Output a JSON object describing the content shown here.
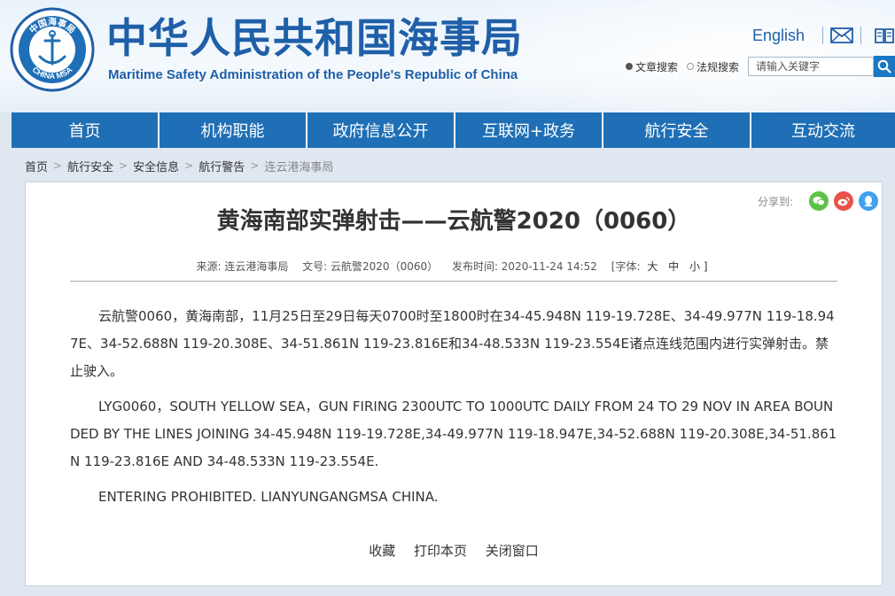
{
  "header": {
    "logo_text_top": "中国海事局",
    "logo_text_bottom": "CHINA MSA",
    "title_cn": "中华人民共和国海事局",
    "title_en": "Maritime Safety Administration of the People's Republic of China",
    "lang_link": "English",
    "search_options": [
      "文章搜索",
      "法规搜索"
    ],
    "search_placeholder": "请输入关键字",
    "accent": "#1f5fa8"
  },
  "nav": {
    "items": [
      "首页",
      "机构职能",
      "政府信息公开",
      "互联网+政务",
      "航行安全",
      "互动交流"
    ],
    "background": "#1f6fb6"
  },
  "breadcrumb": [
    "首页",
    "航行安全",
    "安全信息",
    "航行警告",
    "连云港海事局"
  ],
  "article": {
    "share_label": "分享到:",
    "title": "黄海南部实弹射击——云航警2020（0060）",
    "meta": {
      "source": "来源: 连云港海事局",
      "doc_no": "文号: 云航警2020（0060）",
      "published": "发布时间: 2020-11-24 14:52",
      "font_label": "[字体:",
      "font_large": "大",
      "font_medium": "中",
      "font_small": "小 ]"
    },
    "paragraphs": [
      "云航警0060，黄海南部，11月25日至29日每天0700时至1800时在34-45.948N 119-19.728E、34-49.977N 119-18.947E、34-52.688N 119-20.308E、34-51.861N 119-23.816E和34-48.533N 119-23.554E诸点连线范围内进行实弹射击。禁止驶入。",
      "LYG0060，SOUTH YELLOW SEA，GUN FIRING 2300UTC TO 1000UTC DAILY FROM 24 TO 29 NOV IN AREA BOUNDED BY THE LINES JOINING 34-45.948N 119-19.728E,34-49.977N 119-18.947E,34-52.688N 119-20.308E,34-51.861N 119-23.816E AND 34-48.533N 119-23.554E.",
      "ENTERING PROHIBITED. LIANYUNGANGMSA CHINA."
    ],
    "actions": [
      "收藏",
      "打印本页",
      "关闭窗口"
    ]
  }
}
